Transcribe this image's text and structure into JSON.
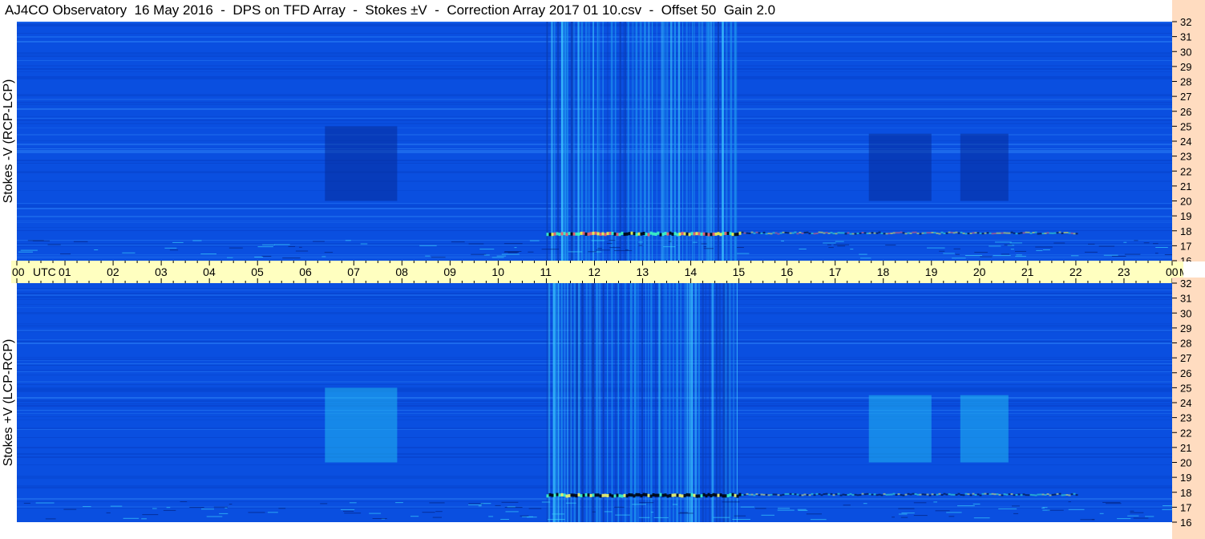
{
  "title": "AJ4CO Observatory  16 May 2016  -  DPS on TFD Array  -  Stokes ±V  -  Correction Array 2017 01 10.csv  -  Offset 50  Gain 2.0",
  "chart_data": {
    "type": "heatmap",
    "panels": [
      {
        "ylabel": "Stokes -V (RCP-LCP)"
      },
      {
        "ylabel": "Stokes +V (LCP-RCP)"
      }
    ],
    "x_tick_labels": [
      "00",
      "01",
      "02",
      "03",
      "04",
      "05",
      "06",
      "07",
      "08",
      "09",
      "10",
      "11",
      "12",
      "13",
      "14",
      "15",
      "16",
      "17",
      "18",
      "19",
      "20",
      "21",
      "22",
      "23",
      "00"
    ],
    "x_unit_left": "UTC",
    "x_unit_right": "MHz",
    "y_tick_labels": [
      "16",
      "17",
      "18",
      "19",
      "20",
      "21",
      "22",
      "23",
      "24",
      "25",
      "26",
      "27",
      "28",
      "29",
      "30",
      "31",
      "32"
    ],
    "ylim_mhz": [
      16,
      32
    ],
    "xlim_utc_hours": [
      0,
      24
    ],
    "features": [
      {
        "panel": 1,
        "start_utc": 6.4,
        "end_utc": 7.9,
        "low_mhz": 20,
        "high_mhz": 25,
        "effect": "darker"
      },
      {
        "panel": 1,
        "start_utc": 17.7,
        "end_utc": 19.0,
        "low_mhz": 20,
        "high_mhz": 24.5,
        "effect": "darker"
      },
      {
        "panel": 1,
        "start_utc": 19.6,
        "end_utc": 20.6,
        "low_mhz": 20,
        "high_mhz": 24.5,
        "effect": "darker"
      },
      {
        "panel": 2,
        "start_utc": 6.4,
        "end_utc": 7.9,
        "low_mhz": 20,
        "high_mhz": 25,
        "effect": "brighter"
      },
      {
        "panel": 2,
        "start_utc": 17.7,
        "end_utc": 19.0,
        "low_mhz": 20,
        "high_mhz": 24.5,
        "effect": "brighter"
      },
      {
        "panel": 2,
        "start_utc": 19.6,
        "end_utc": 20.6,
        "low_mhz": 20,
        "high_mhz": 24.5,
        "effect": "brighter"
      }
    ],
    "interference_bands_utc": [
      [
        11.0,
        15.0
      ]
    ],
    "colors": {
      "background": "#0a4fe0",
      "axis_bg": "#ffffc0",
      "freq_axis_bg": "#ffdcc0"
    }
  }
}
